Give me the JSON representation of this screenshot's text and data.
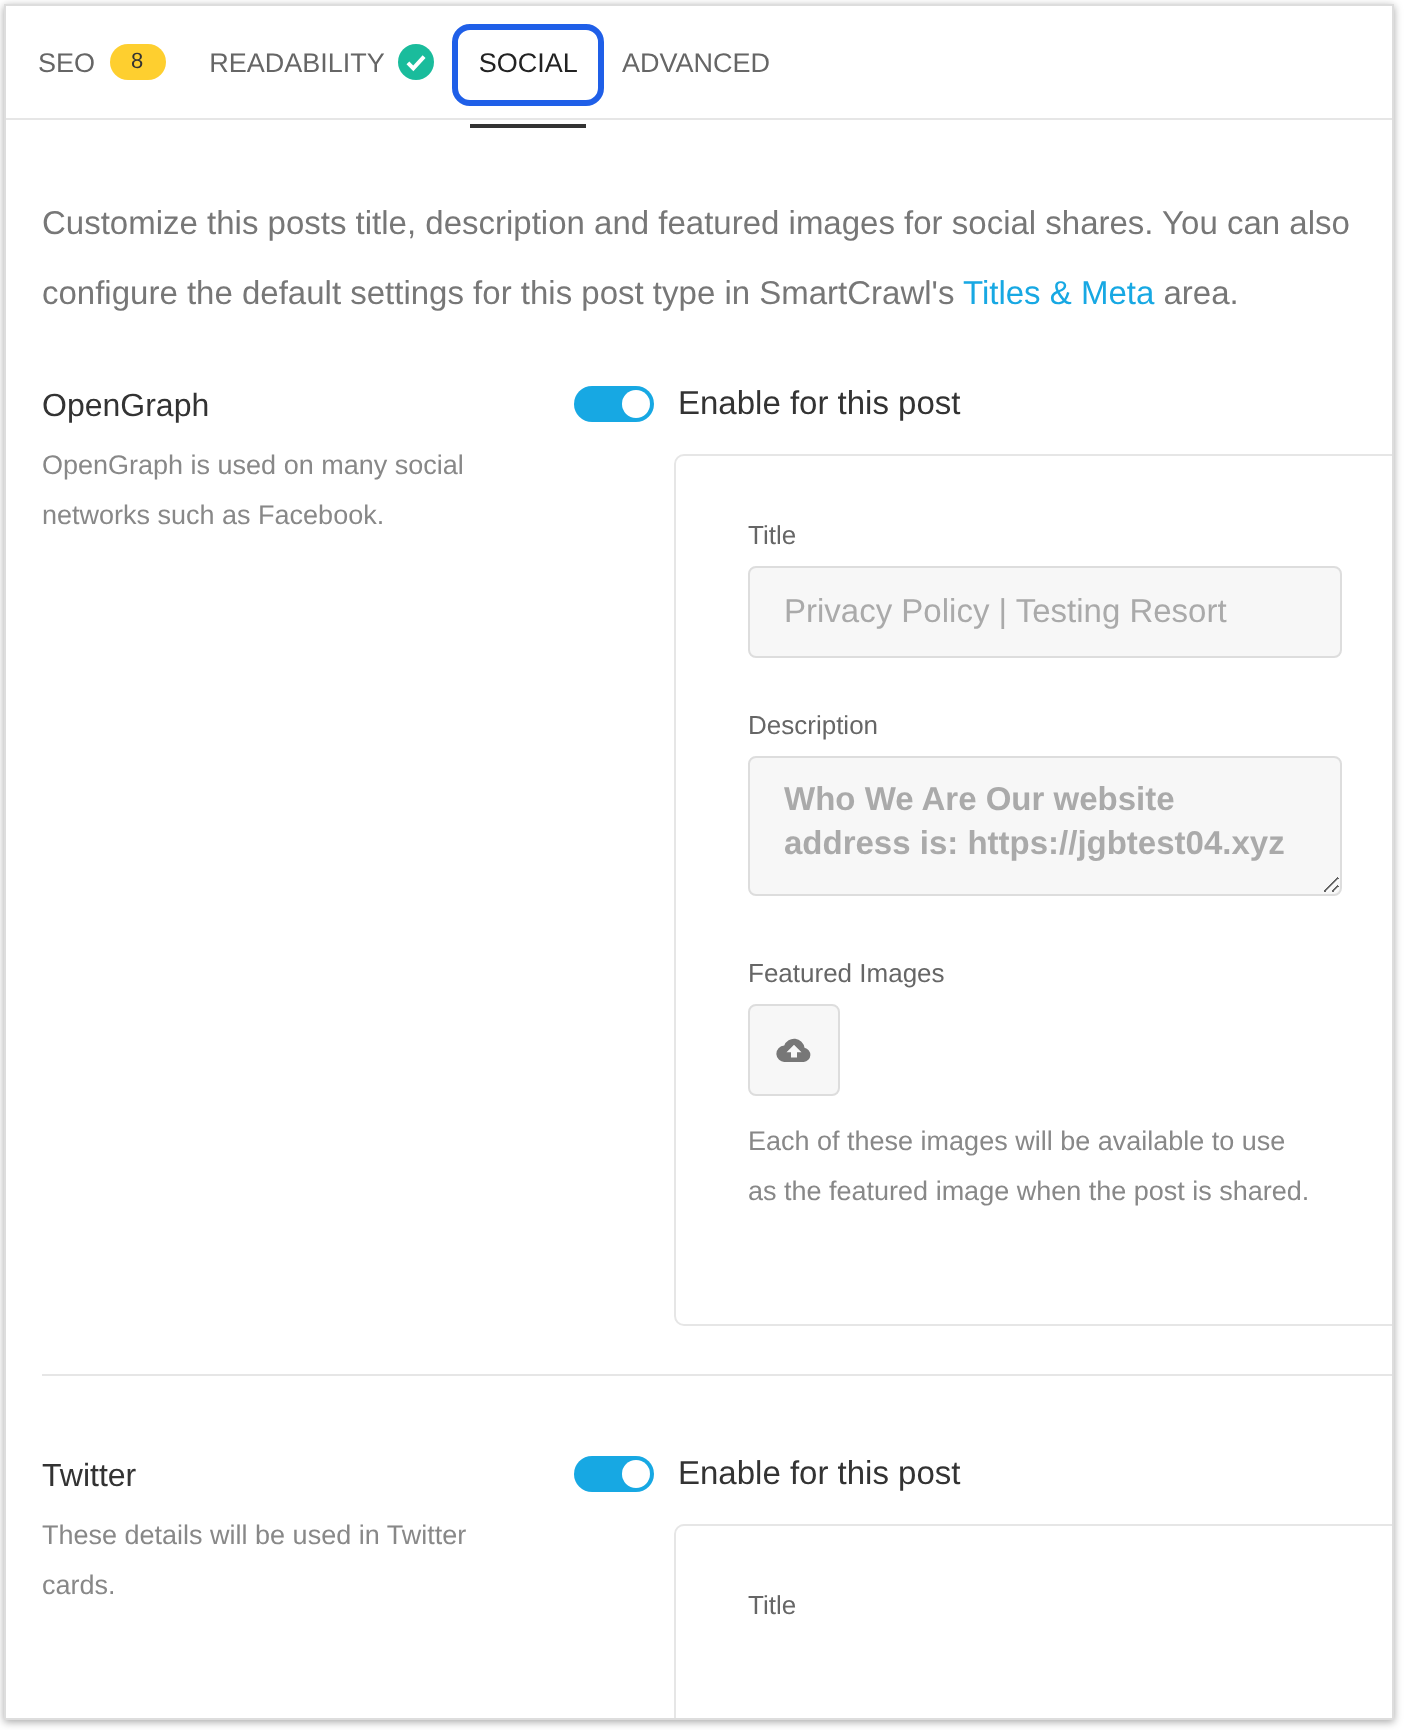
{
  "tabs": [
    {
      "label": "SEO",
      "badge": "8",
      "selected": false
    },
    {
      "label": "READABILITY",
      "check": true,
      "selected": false
    },
    {
      "label": "SOCIAL",
      "selected": true
    },
    {
      "label": "ADVANCED",
      "selected": false
    }
  ],
  "intro": {
    "text": "Customize this posts title, description and featured images for social shares. You can also configure the default settings for this post type in SmartCrawl's",
    "link": "Titles & Meta",
    "after": "area."
  },
  "sections": [
    {
      "title": "OpenGraph",
      "description": "OpenGraph is used on many social networks such as Facebook.",
      "toggle": {
        "label": "Enable for this post",
        "on": true
      },
      "fields": [
        {
          "kind": "input",
          "label": "Title",
          "value": "Privacy Policy | Testing Resort"
        },
        {
          "kind": "textarea",
          "label": "Description",
          "value": "Who We Are Our website address is: https://jgbtest04.xyz"
        },
        {
          "kind": "images",
          "label": "Featured Images",
          "help": "Each of these images will be available to use as the featured image when the post is shared."
        }
      ]
    },
    {
      "title": "Twitter",
      "description": "These details will be used in Twitter cards.",
      "toggle": {
        "label": "Enable for this post",
        "on": true
      },
      "fields": [
        {
          "kind": "heading",
          "label": "Title"
        }
      ]
    }
  ]
}
